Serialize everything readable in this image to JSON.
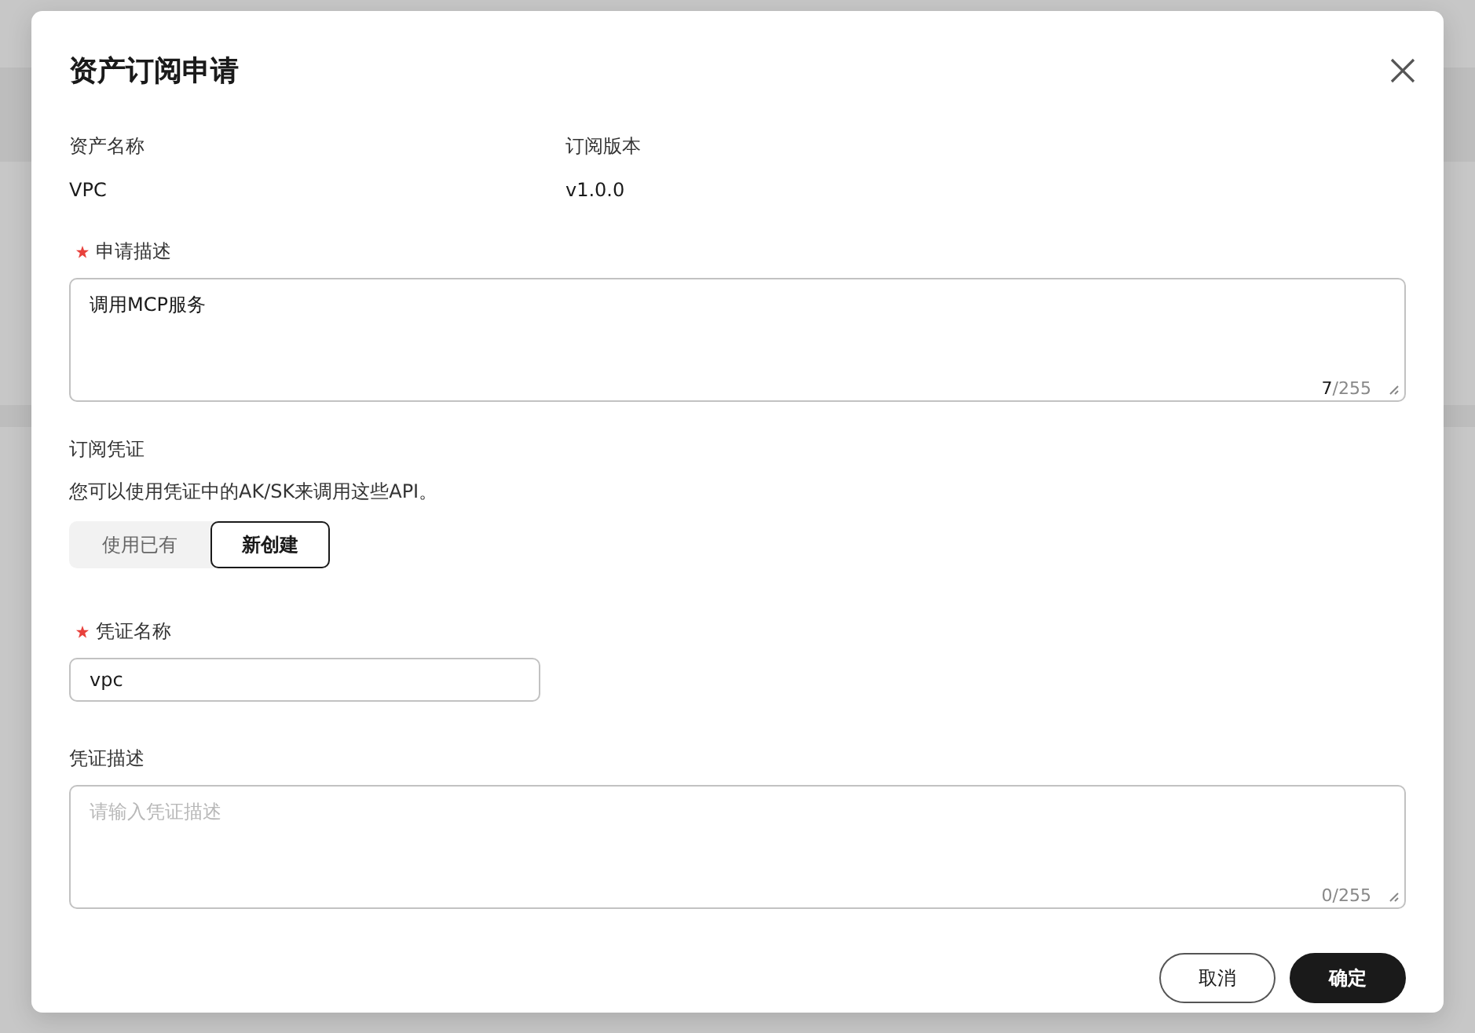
{
  "dialog": {
    "title": "资产订阅申请",
    "info": [
      {
        "label": "资产名称",
        "value": "VPC"
      },
      {
        "label": "订阅版本",
        "value": "v1.0.0"
      }
    ],
    "description_field": {
      "label": "申请描述",
      "required": true,
      "value": "调用MCP服务",
      "counter": "**7**/255"
    },
    "credential": {
      "title": "订阅凭证",
      "hint": "您可以使用凭证中的AK/SK来调用这些API。",
      "options": [
        {
          "label": "使用已有",
          "selected": false
        },
        {
          "label": "新创建",
          "selected": true
        }
      ]
    },
    "credential_name": {
      "label": "凭证名称",
      "required": true,
      "value": "vpc"
    },
    "credential_description": {
      "label": "凭证描述",
      "required": false,
      "placeholder": "请输入凭证描述",
      "counter": "0/255"
    },
    "buttons": [
      {
        "label": "取消",
        "kind": "secondary"
      },
      {
        "label": "确定",
        "kind": "primary"
      }
    ]
  }
}
